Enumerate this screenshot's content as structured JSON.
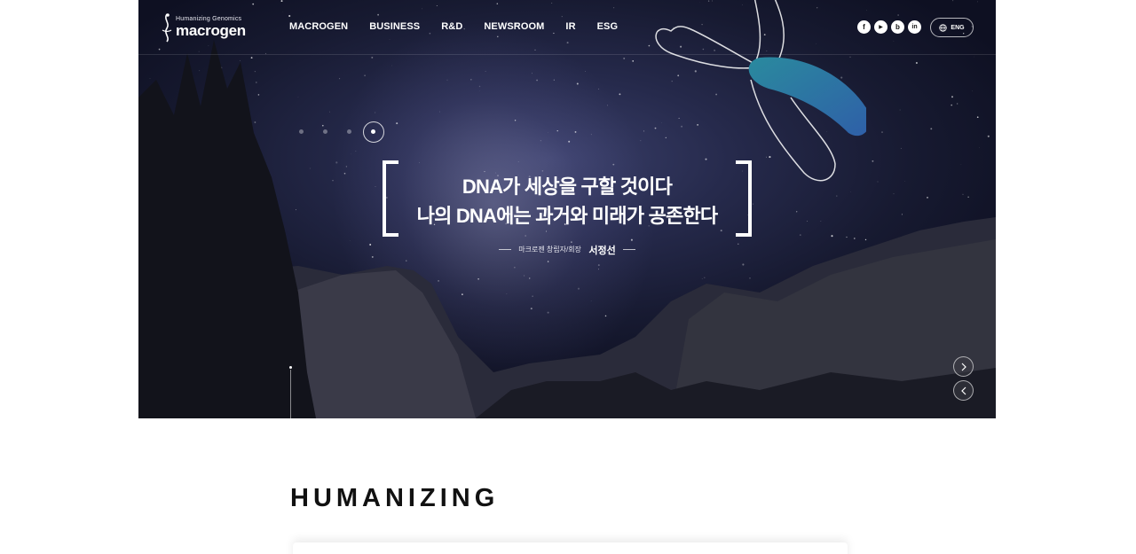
{
  "brand": {
    "tagline": "Humanizing Genomics",
    "name": "macrogen"
  },
  "nav": {
    "items": [
      {
        "label": "MACROGEN"
      },
      {
        "label": "BUSINESS"
      },
      {
        "label": "R&D"
      },
      {
        "label": "NEWSROOM"
      },
      {
        "label": "IR"
      },
      {
        "label": "ESG"
      }
    ]
  },
  "social": {
    "facebook": "f",
    "youtube": "▶",
    "blog": "b",
    "linkedin": "in"
  },
  "language": {
    "label": "ENG",
    "icon": "globe-icon"
  },
  "hero": {
    "quote_line1": "DNA가 세상을 구할 것이다",
    "quote_line2": "나의 DNA에는 과거와 미래가 공존한다",
    "attribution_role": "마크로젠 창립자/회장",
    "attribution_name": "서정선",
    "slide_count": 4,
    "active_slide": 4
  },
  "section": {
    "title": "HUMANIZING"
  },
  "colors": {
    "chromosome_gradient_start": "#2a8a9e",
    "chromosome_gradient_end": "#2f5fa8",
    "night_sky": "#1b1e38"
  }
}
